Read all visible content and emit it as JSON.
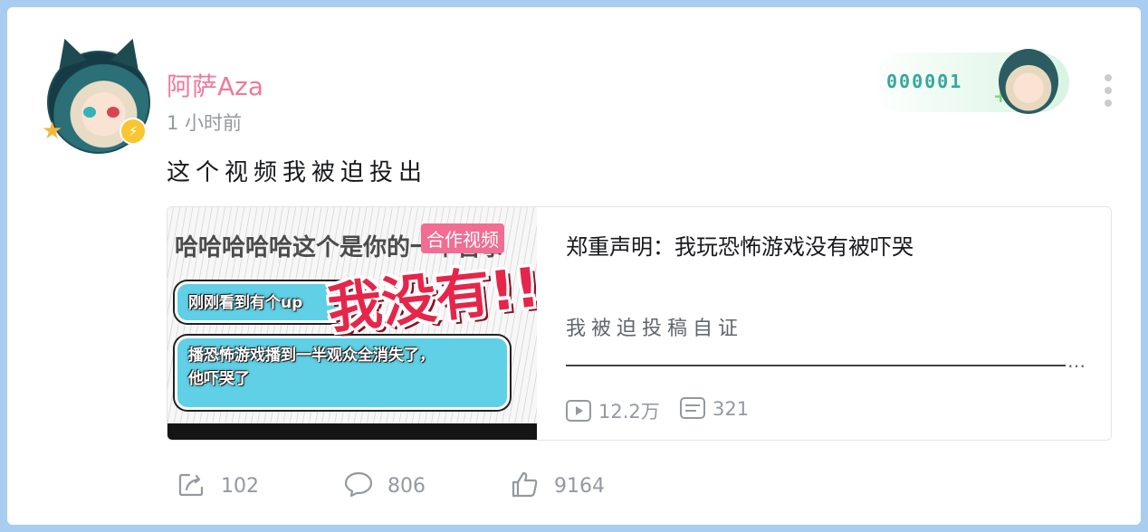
{
  "post": {
    "username": "阿萨Aza",
    "time": "1 小时前",
    "text": "这个视频我被迫投出"
  },
  "fan_badge": {
    "number": "000001"
  },
  "video": {
    "thumbnail": {
      "collab_badge": "合作视频",
      "bg_text": "哈哈哈哈哈这个是你的一个吉事",
      "bubble_1": "刚刚看到有个up",
      "bubble_2_line1": "播恐怖游戏播到一半观众全消失了，",
      "bubble_2_line2": "他吓哭了",
      "big_text": "我没有!!"
    },
    "title": "郑重声明：我玩恐怖游戏没有被吓哭",
    "desc": "我被迫投稿自证",
    "ellipsis": "…",
    "plays": "12.2万",
    "danmaku": "321"
  },
  "actions": {
    "forward": "102",
    "comment": "806",
    "like": "9164"
  },
  "colors": {
    "username": "#f0789b",
    "fan_number": "#35a89b",
    "collab_badge": "#f36c92",
    "page_border": "#a9cdf0"
  },
  "icons": [
    "star-icon",
    "lightning-icon",
    "more-vertical-icon",
    "play-icon",
    "danmaku-icon",
    "forward-icon",
    "comment-icon",
    "like-icon"
  ]
}
